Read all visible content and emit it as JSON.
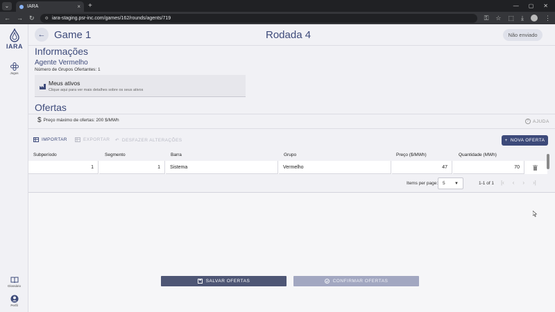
{
  "browser": {
    "tab_title": "IARA",
    "url": "iara-staging.psr-inc.com/games/162/rounds/agents/719"
  },
  "sidebar": {
    "logo_text": "IARA",
    "items": [
      {
        "label": "Jogos",
        "icon": "games-icon"
      },
      {
        "label": "Glossário",
        "icon": "book-icon"
      },
      {
        "label": "Perfil",
        "icon": "person-icon"
      }
    ]
  },
  "header": {
    "game_title": "Game 1",
    "round_title": "Rodada 4",
    "status": "Não enviado"
  },
  "info": {
    "section_title": "Informações",
    "agent_name": "Agente Vermelho",
    "group_count": "Número de Grupos Ofertantes: 1",
    "assets_title": "Meus ativos",
    "assets_subtitle": "Clique aqui para ver mais detalhes sobre os seus ativos"
  },
  "offers": {
    "section_title": "Ofertas",
    "max_price": "Preço máximo de ofertas: 200 $/MWh",
    "help_label": "AJUDA",
    "toolbar": {
      "import_label": "IMPORTAR",
      "export_label": "EXPORTAR",
      "undo_label": "DESFAZER ALTERAÇÕES",
      "new_offer_label": "NOVA OFERTA"
    },
    "columns": [
      "Subperíodo",
      "Segmento",
      "Barra",
      "Grupo",
      "Preço ($/MWh)",
      "Quantidade (MWh)"
    ],
    "rows": [
      {
        "subperiodo": "1",
        "segmento": "1",
        "barra": "Sistema",
        "grupo": "Vermelho",
        "preco": "47",
        "quantidade": "70"
      }
    ],
    "pagination": {
      "items_per_page_label": "Items per page:",
      "items_per_page": "5",
      "range": "1-1 of 1"
    }
  },
  "actions": {
    "save_label": "SALVAR OFERTAS",
    "confirm_label": "CONFIRMAR OFERTAS"
  },
  "colors": {
    "primary": "#3d4a7a",
    "save_button": "#4e5675",
    "confirm_button": "#a2a7c1"
  }
}
